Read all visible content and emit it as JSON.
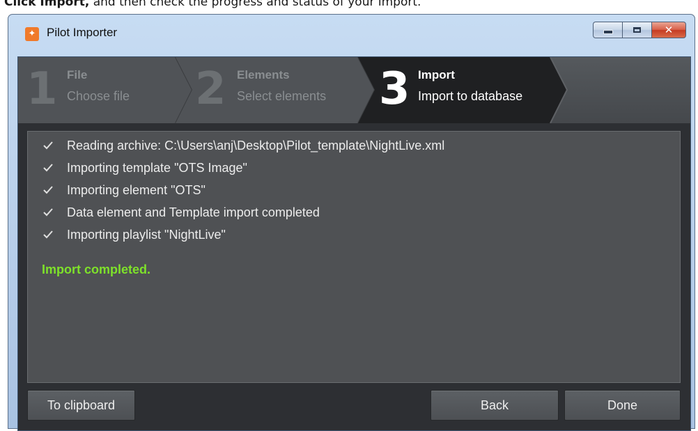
{
  "caption": {
    "bold_part": "Click Import,",
    "rest": " and then check the progress and status of your import."
  },
  "window": {
    "title": "Pilot Importer",
    "icon": "pilot-app-icon"
  },
  "steps": [
    {
      "number": "1",
      "title": "File",
      "subtitle": "Choose file",
      "state": "inactive"
    },
    {
      "number": "2",
      "title": "Elements",
      "subtitle": "Select elements",
      "state": "inactive"
    },
    {
      "number": "3",
      "title": "Import",
      "subtitle": "Import to database",
      "state": "active"
    }
  ],
  "log": {
    "lines": [
      "Reading archive: C:\\Users\\anj\\Desktop\\Pilot_template\\NightLive.xml",
      "Importing template \"OTS Image\"",
      "Importing element \"OTS\"",
      "Data element and Template import completed",
      "Importing playlist \"NightLive\""
    ],
    "status": "Import completed.",
    "status_color": "#7ee12a"
  },
  "buttons": {
    "clipboard": "To clipboard",
    "back": "Back",
    "done": "Done"
  }
}
